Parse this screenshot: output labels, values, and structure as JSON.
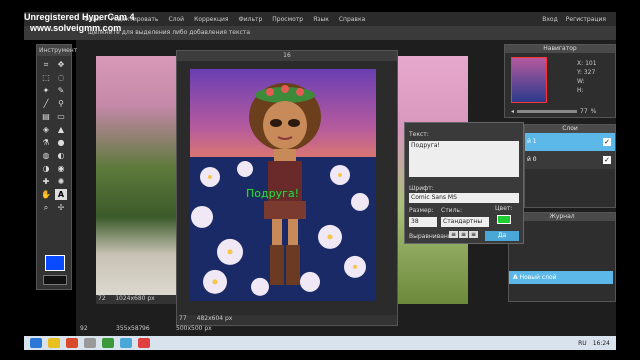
{
  "watermark": {
    "line1": "Unregistered HyperCam 4",
    "line2": "www.solveigmm.com"
  },
  "menu": {
    "items": [
      "Файл",
      "Редактировать",
      "Слой",
      "Коррекция",
      "Фильтр",
      "Просмотр",
      "Язык",
      "Справка"
    ],
    "login": "Вход",
    "register": "Регистрация"
  },
  "options_hint": "щелкните для выделения либо добавления текста",
  "toolbox": {
    "title": "Инструмент",
    "tools": [
      "crop-icon",
      "move-icon",
      "marquee-icon",
      "lasso-icon",
      "wand-icon",
      "pencil-icon",
      "brush-icon",
      "clone-icon",
      "gradient-icon",
      "eraser-icon",
      "bucket-icon",
      "sharpen-icon",
      "dropper-icon",
      "blur-icon",
      "sponge-icon",
      "dodge-icon",
      "burn-icon",
      "redeye-icon",
      "spot-icon",
      "bloat-icon",
      "hand-icon",
      "text-icon",
      "zoom-icon",
      "pan-icon"
    ],
    "fg_color": "#0a4bff"
  },
  "doc_back": {
    "zoom": "72",
    "size": "1024x680 px"
  },
  "doc_main": {
    "title": "16",
    "caption": "Подруга!",
    "zoom": "77",
    "size": "482x604 px"
  },
  "doc_footer": {
    "zoom1": "92",
    "size1": "355x587",
    "zoom2": "96",
    "size2": "500x500 px"
  },
  "navigator": {
    "title": "Навигатор",
    "x_label": "X:",
    "x": "101",
    "y_label": "Y:",
    "y": "327",
    "w_label": "W:",
    "h_label": "H:",
    "zoom": "77",
    "unit": "%"
  },
  "layers": {
    "title": "Слои",
    "items": [
      {
        "label": "й 1"
      },
      {
        "label": "й 0"
      }
    ]
  },
  "history": {
    "title": "Журнал",
    "items": [
      "",
      "",
      "",
      ""
    ],
    "selected": "Новый слой"
  },
  "text_dialog": {
    "text_label": "Текст:",
    "text_value": "Подруга!",
    "font_label": "Шрифт:",
    "font_value": "Comic Sans MS",
    "size_label": "Размер:",
    "size_value": "38",
    "style_label": "Стиль:",
    "style_value": "Стандартны",
    "color_label": "Цвет:",
    "color_value": "#22cc33",
    "align_label": "Выравнивание:",
    "ok_label": "Да"
  },
  "taskbar": {
    "lang": "RU",
    "clock": "16:24"
  }
}
